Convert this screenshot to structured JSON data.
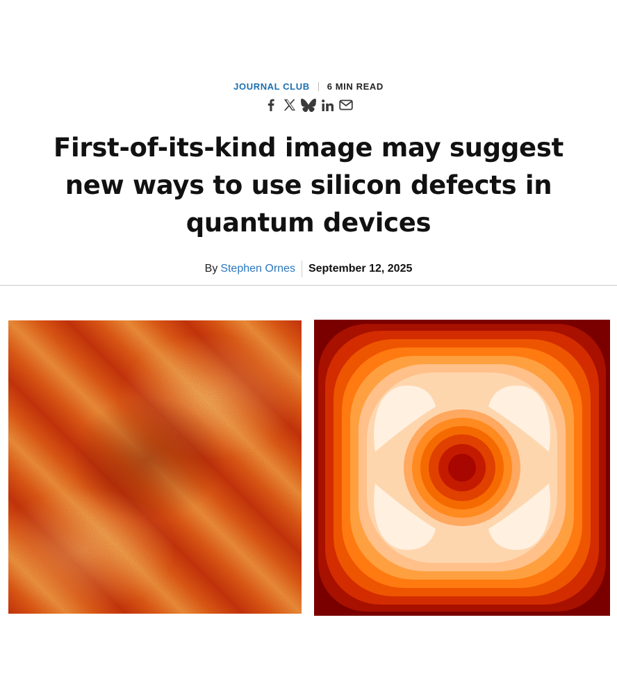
{
  "article": {
    "category": "JOURNAL CLUB",
    "read_time": "6 MIN READ",
    "title": "First-of-its-kind image may suggest new ways to use silicon defects in quantum devices",
    "byline_prefix": "By",
    "author": "Stephen Ornes",
    "date": "September 12, 2025"
  },
  "share": {
    "icons": [
      "facebook-icon",
      "x-icon",
      "bluesky-icon",
      "linkedin-icon",
      "email-icon"
    ]
  },
  "colors": {
    "accent": "#1a6fb0",
    "author_link": "#2a77bd",
    "icon": "#3a3a3a",
    "heat_dark": "#8b0000",
    "heat_mid": "#ff6a10",
    "heat_light": "#fde4c8"
  }
}
